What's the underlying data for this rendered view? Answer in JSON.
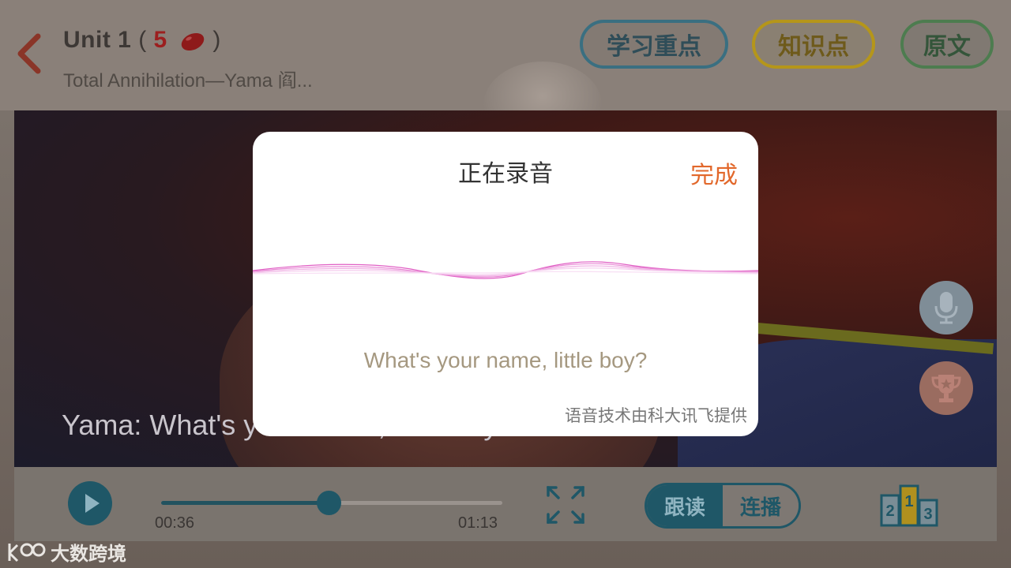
{
  "header": {
    "unit_label": "Unit 1",
    "paren_open": "(",
    "paren_close": ")",
    "bean_count": "5",
    "lesson_title": "Total Annihilation—Yama 阎...",
    "buttons": {
      "key_points": "学习重点",
      "knowledge": "知识点",
      "original_text": "原文"
    }
  },
  "video": {
    "subtitle": "Yama: What's your name, little boy?"
  },
  "player": {
    "current_time": "00:36",
    "total_time": "01:13",
    "progress": 0.49,
    "modes": {
      "follow_read": "跟读",
      "continuous": "连播"
    },
    "rank_numbers": [
      "2",
      "1",
      "3"
    ]
  },
  "recording_dialog": {
    "title": "正在录音",
    "done_label": "完成",
    "prompt": "What's your name, little boy?",
    "credit": "语音技术由科大讯飞提供"
  },
  "watermark": {
    "text": "大数跨境"
  },
  "colors": {
    "accent_orange": "#e2682b",
    "teal": "#1f5767",
    "wave_pink": "#e05fc4"
  }
}
